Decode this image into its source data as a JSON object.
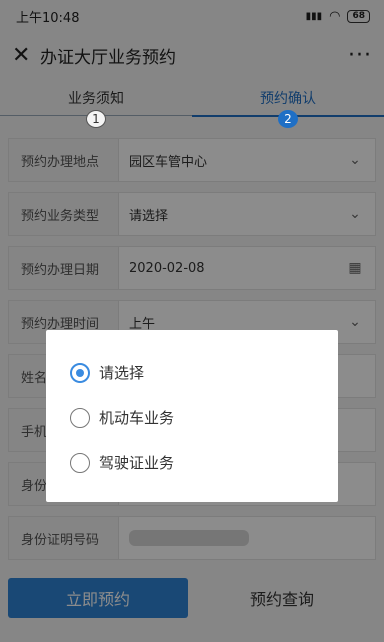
{
  "status_bar": {
    "time": "上午10:48",
    "signal": "▮▮▮",
    "wifi": "◠",
    "battery": "68"
  },
  "header": {
    "close_icon": "✕",
    "title": "办证大厅业务预约",
    "more_icon": "···"
  },
  "steps": [
    {
      "label": "业务须知",
      "num": "1",
      "active": false
    },
    {
      "label": "预约确认",
      "num": "2",
      "active": true
    }
  ],
  "form": {
    "rows": [
      {
        "label": "预约办理地点",
        "value": "园区车管中心",
        "icon": "⌄"
      },
      {
        "label": "预约业务类型",
        "value": "请选择",
        "icon": "⌄"
      },
      {
        "label": "预约办理日期",
        "value": "2020-02-08",
        "icon": "▦"
      },
      {
        "label": "预约办理时间",
        "value": "上午",
        "icon": "⌄"
      },
      {
        "label": "姓名",
        "value": "",
        "icon": ""
      },
      {
        "label": "手机号码",
        "value": "",
        "icon": ""
      },
      {
        "label": "身份证件",
        "value": "",
        "icon": ""
      },
      {
        "label": "身份证明号码",
        "value": "",
        "icon": ""
      }
    ]
  },
  "footer": {
    "submit_label": "立即预约",
    "query_label": "预约查询"
  },
  "dialog": {
    "options": [
      {
        "label": "请选择",
        "checked": true
      },
      {
        "label": "机动车业务",
        "checked": false
      },
      {
        "label": "驾驶证业务",
        "checked": false
      }
    ]
  },
  "colors": {
    "accent": "#2f84d6",
    "radio_accent": "#3a8be0"
  }
}
